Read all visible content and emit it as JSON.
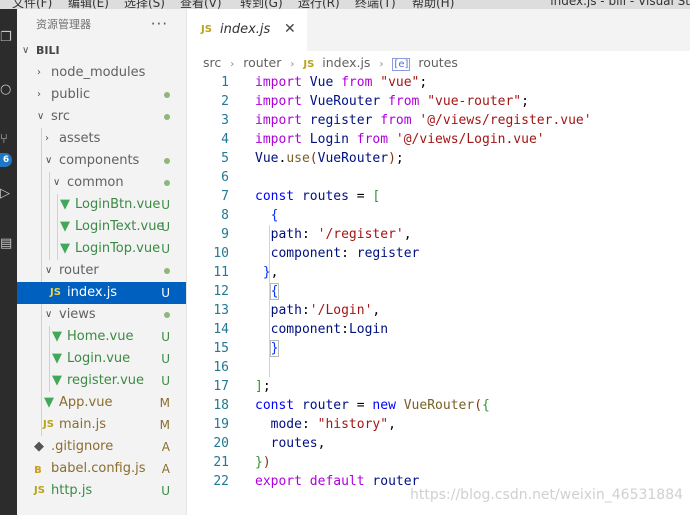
{
  "menubar": {
    "items": [
      "文件(F)",
      "编辑(E)",
      "选择(S)",
      "查看(V)",
      "转到(G)",
      "运行(R)",
      "终端(T)",
      "帮助(H)"
    ],
    "title": "index.js - bili - Visual St"
  },
  "activitybar": {
    "badge": "6",
    "icons": [
      "files-icon",
      "search-icon",
      "source-control-icon",
      "run-icon",
      "extensions-icon"
    ]
  },
  "explorer": {
    "header": "资源管理器",
    "more": "···",
    "root": "BILI",
    "items": [
      {
        "label": "node_modules",
        "status": ""
      },
      {
        "label": "public",
        "status": ""
      },
      {
        "label": "src",
        "status": ""
      },
      {
        "label": "assets",
        "status": ""
      },
      {
        "label": "components",
        "status": ""
      },
      {
        "label": "common",
        "status": ""
      },
      {
        "label": "LoginBtn.vue",
        "status": "U"
      },
      {
        "label": "LoginText.vue",
        "status": "U"
      },
      {
        "label": "LoginTop.vue",
        "status": "U"
      },
      {
        "label": "router",
        "status": ""
      },
      {
        "label": "index.js",
        "status": "U"
      },
      {
        "label": "views",
        "status": ""
      },
      {
        "label": "Home.vue",
        "status": "U"
      },
      {
        "label": "Login.vue",
        "status": "U"
      },
      {
        "label": "register.vue",
        "status": "U"
      },
      {
        "label": "App.vue",
        "status": "M"
      },
      {
        "label": "main.js",
        "status": "M"
      },
      {
        "label": ".gitignore",
        "status": "A"
      },
      {
        "label": "babel.config.js",
        "status": "A"
      },
      {
        "label": "http.js",
        "status": "U"
      }
    ]
  },
  "tab": {
    "icon": "JS",
    "label": "index.js",
    "close": "✕"
  },
  "breadcrumb": {
    "parts": [
      "src",
      "router",
      "index.js",
      "routes"
    ],
    "file_icon": "JS",
    "symbol_icon": "[e]"
  },
  "code": {
    "line_numbers": [
      "1",
      "2",
      "3",
      "4",
      "5",
      "6",
      "7",
      "8",
      "9",
      "10",
      "11",
      "12",
      "13",
      "14",
      "15",
      "16",
      "17",
      "18",
      "19",
      "20",
      "21",
      "22"
    ],
    "lines": [
      "import Vue from \"vue\";",
      "import VueRouter from \"vue-router\";",
      "import register from '@/views/register.vue'",
      "import Login from '@/views/Login.vue'",
      "Vue.use(VueRouter);",
      "",
      "const routes = [",
      "  {",
      "  path: '/register',",
      "  component: register",
      " },",
      "  {",
      "  path:'/Login',",
      "  component:Login",
      "  }",
      "",
      "];",
      "const router = new VueRouter({",
      "  mode: \"history\",",
      "  routes,",
      "})",
      "export default router"
    ]
  },
  "watermark": "https://blog.csdn.net/weixin_46531884"
}
